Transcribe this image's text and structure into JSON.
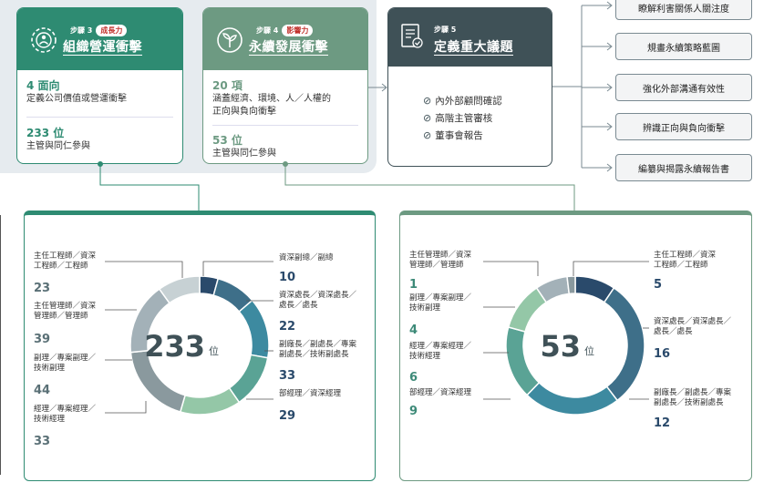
{
  "colors": {
    "green": "#2e8b72",
    "sage": "#6d9a82",
    "slate": "#3f5157",
    "navy": "#2a4a6b",
    "teal": "#3d8aa0",
    "mint": "#94c7a7",
    "grey": "#a3b1b8"
  },
  "step3": {
    "step_label": "步驟 3",
    "tag": "成長力",
    "title": "組織營運衝擊",
    "stat1_num": "4 面向",
    "stat1_desc": "定義公司價值或營運衝擊",
    "stat2_num": "233 位",
    "stat2_desc": "主管與同仁參與"
  },
  "step4": {
    "step_label": "步驟 4",
    "tag": "影響力",
    "title": "永續發展衝擊",
    "stat1_num": "20 項",
    "stat1_desc_l1": "涵蓋經濟、環境、人／人權的",
    "stat1_desc_l2": "正向與負向衝擊",
    "stat2_num": "53 位",
    "stat2_desc": "主管與同仁參與"
  },
  "step5": {
    "step_label": "步驟 5",
    "title": "定義重大議題",
    "checks": [
      "內外部顧問確認",
      "高階主管審核",
      "董事會報告"
    ]
  },
  "flows": [
    "瞭解利害關係人關注度",
    "規畫永續策略藍圖",
    "強化外部溝通有效性",
    "辨識正向與負向衝擊",
    "編纂與揭露永續報告書"
  ],
  "chart_data": [
    {
      "type": "pie",
      "center_value": "233",
      "center_unit": "位",
      "categories": [
        "資深副總／副總",
        "資深處長／資深處長／處長／處長",
        "副廠長／副處長／專案副處長／技術副處長",
        "部經理／資深經理",
        "經理／專案經理／技術經理",
        "副理／專案副理／技術副理",
        "主任管理師／資深管理師／管理師",
        "主任工程師／資深工程師／工程師"
      ],
      "labels": [
        [
          "資深副總／副總"
        ],
        [
          "資深處長／資深處長／",
          "處長／處長"
        ],
        [
          "副廠長／副處長／專案",
          "副處長／技術副處長"
        ],
        [
          "部經理／資深經理"
        ],
        [
          "經理／專案經理／",
          "技術經理"
        ],
        [
          "副理／專案副理／",
          "技術副理"
        ],
        [
          "主任管理師／資深",
          "管理師／管理師"
        ],
        [
          "主任工程師／資深",
          "工程師／工程師"
        ]
      ],
      "values": [
        10,
        22,
        33,
        29,
        33,
        44,
        39,
        23
      ],
      "colors": [
        "#2a4a6b",
        "#3e6f89",
        "#3d8aa0",
        "#5aa395",
        "#94c7a7",
        "#8a999e",
        "#a3b1b8",
        "#c7d1d4"
      ]
    },
    {
      "type": "pie",
      "center_value": "53",
      "center_unit": "位",
      "categories": [
        "主任工程師／資深工程師／工程師",
        "資深處長／資深處長／處長",
        "副廠長／副處長／專案副處長／技術副處長",
        "部經理／資深經理",
        "經理／專案經理／技術經理",
        "副理／專案副理／技術副理",
        "主任管理師／資深管理師／管理師"
      ],
      "labels": [
        [
          "主任工程師／資深",
          "工程師／工程師"
        ],
        [
          "資深處長／資深處長／",
          "處長／處長"
        ],
        [
          "副廠長／副處長／專案",
          "副處長／技術副處長"
        ],
        [
          "部經理／資深經理"
        ],
        [
          "經理／專案經理／",
          "技術經理"
        ],
        [
          "副理／專案副理／",
          "技術副理"
        ],
        [
          "主任管理師／資深",
          "管理師／管理師"
        ]
      ],
      "values": [
        5,
        16,
        12,
        9,
        6,
        4,
        1
      ],
      "colors": [
        "#2a4a6b",
        "#3e6f89",
        "#3d8aa0",
        "#5aa395",
        "#94c7a7",
        "#a3b1b8",
        "#8a999e"
      ]
    }
  ]
}
